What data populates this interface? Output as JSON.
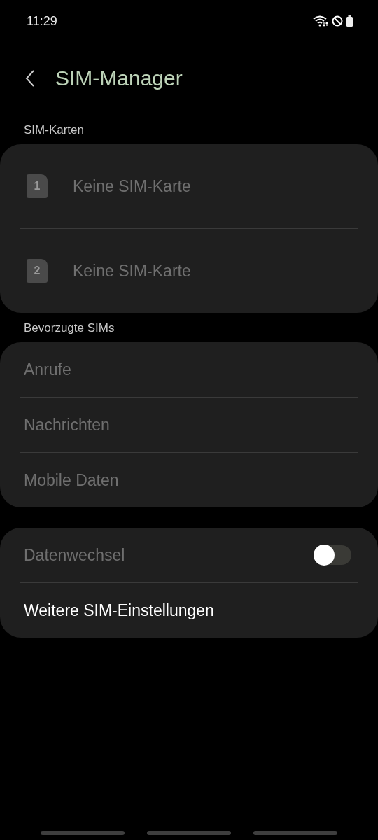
{
  "status_bar": {
    "time": "11:29"
  },
  "header": {
    "title": "SIM-Manager"
  },
  "sections": [
    {
      "label": "SIM-Karten",
      "rows": [
        {
          "kind": "sim",
          "slot": "1",
          "label": "Keine SIM-Karte",
          "disabled": true
        },
        {
          "kind": "sim",
          "slot": "2",
          "label": "Keine SIM-Karte",
          "disabled": true
        }
      ]
    },
    {
      "label": "Bevorzugte SIMs",
      "rows": [
        {
          "kind": "plain",
          "label": "Anrufe",
          "disabled": true
        },
        {
          "kind": "plain",
          "label": "Nachrichten",
          "disabled": true
        },
        {
          "kind": "plain",
          "label": "Mobile Daten",
          "disabled": true
        }
      ]
    },
    {
      "rows": [
        {
          "kind": "toggle",
          "label": "Datenwechsel",
          "disabled": true,
          "on": false
        },
        {
          "kind": "plain",
          "label": "Weitere SIM-Einstellungen",
          "disabled": false
        }
      ]
    }
  ]
}
